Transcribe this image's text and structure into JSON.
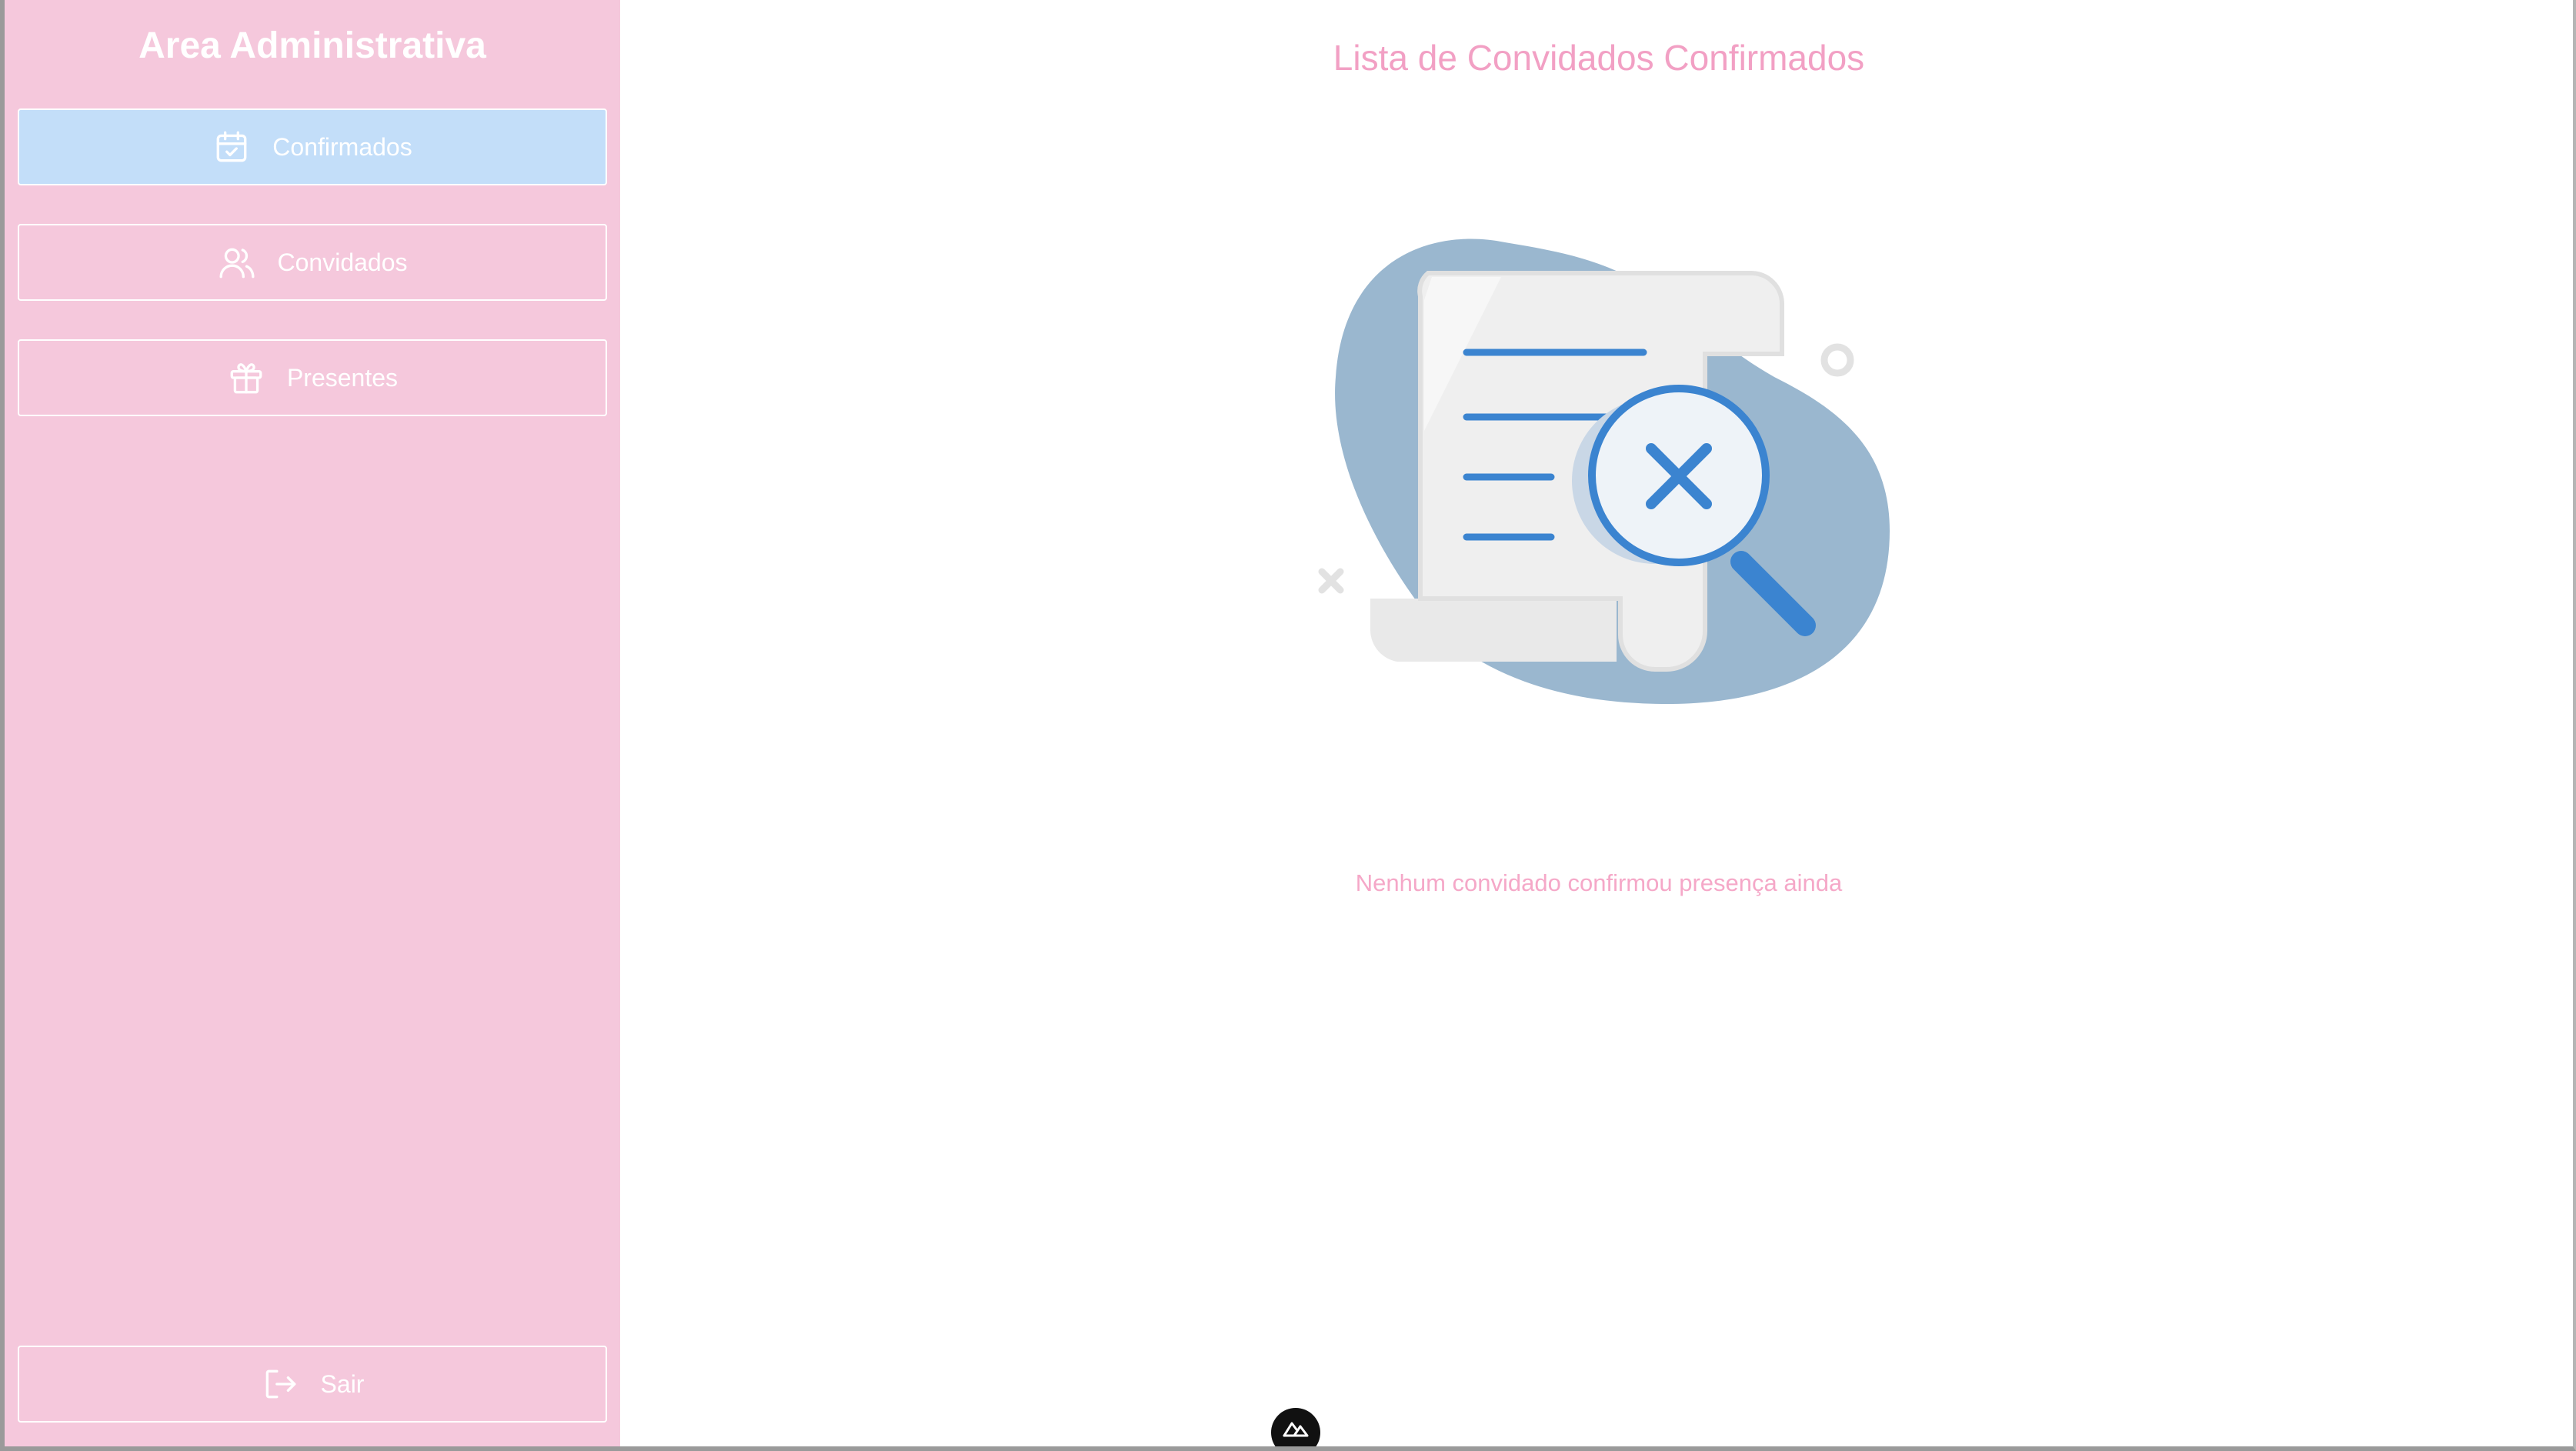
{
  "sidebar": {
    "title": "Area Administrativa",
    "items": [
      {
        "label": "Confirmados",
        "icon": "calendar-check-icon",
        "active": true
      },
      {
        "label": "Convidados",
        "icon": "users-icon",
        "active": false
      },
      {
        "label": "Presentes",
        "icon": "gift-icon",
        "active": false
      }
    ],
    "logout": {
      "label": "Sair",
      "icon": "logout-icon"
    }
  },
  "main": {
    "title": "Lista de Convidados Confirmados",
    "empty_message": "Nenhum convidado confirmou presença ainda",
    "illustration": "empty-search-illustration"
  },
  "devtools": {
    "icon": "nuxt-logo-icon"
  },
  "colors": {
    "sidebar_bg": "#f5c8dc",
    "active_item_bg": "#c3def9",
    "title_pink": "#f2a0c4",
    "illustration_blob": "#9ab7cf",
    "illustration_blue": "#3b84d0"
  }
}
